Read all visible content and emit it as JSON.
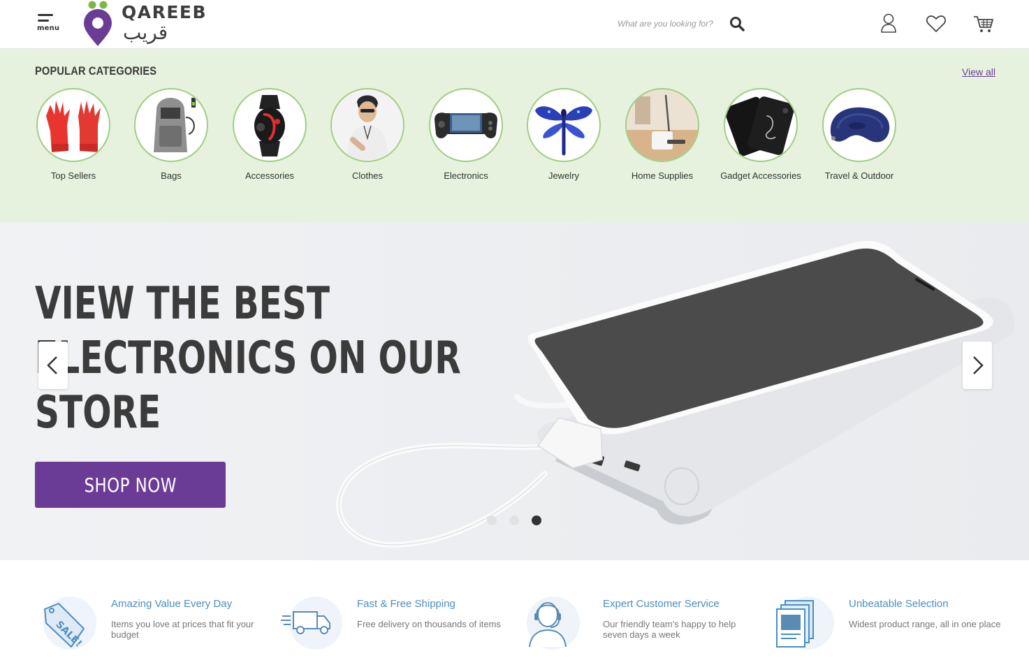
{
  "header": {
    "menu_label": "menu",
    "brand_en": "QAREEB",
    "brand_ar": "قريب",
    "search_placeholder": "What are you looking for?",
    "icons": [
      "menu-icon",
      "search-icon",
      "user-icon",
      "heart-icon",
      "cart-icon"
    ]
  },
  "categories": {
    "title": "POPULAR CATEGORIES",
    "view_all": "View all",
    "items": [
      {
        "label": "Top Sellers"
      },
      {
        "label": "Bags"
      },
      {
        "label": "Accessories"
      },
      {
        "label": "Clothes"
      },
      {
        "label": "Electronics"
      },
      {
        "label": "Jewelry"
      },
      {
        "label": "Home Supplies"
      },
      {
        "label": "Gadget Accessories"
      },
      {
        "label": "Travel & Outdoor"
      }
    ]
  },
  "hero": {
    "title_lines": [
      "VIEW THE BEST",
      "ELECTRONICS ON OUR",
      "STORE"
    ],
    "cta": "SHOP NOW",
    "slides": 3,
    "active_slide": 3
  },
  "features": [
    {
      "title": "Amazing Value Every Day",
      "desc": "Items you love at prices that fit your budget",
      "icon": "sale-tag-icon"
    },
    {
      "title": "Fast & Free Shipping",
      "desc": "Free delivery on thousands of items",
      "icon": "delivery-truck-icon"
    },
    {
      "title": "Expert Customer Service",
      "desc": "Our friendly team's happy to help seven days a week",
      "icon": "support-agent-icon"
    },
    {
      "title": "Unbeatable Selection",
      "desc": "Widest product range, all in one place",
      "icon": "catalog-icon"
    }
  ],
  "colors": {
    "brand_purple": "#6b3c96",
    "category_bg": "#e6f2dd",
    "category_border": "#9fce86",
    "feature_title": "#4a8ec2",
    "logo_green": "#7ab648"
  }
}
